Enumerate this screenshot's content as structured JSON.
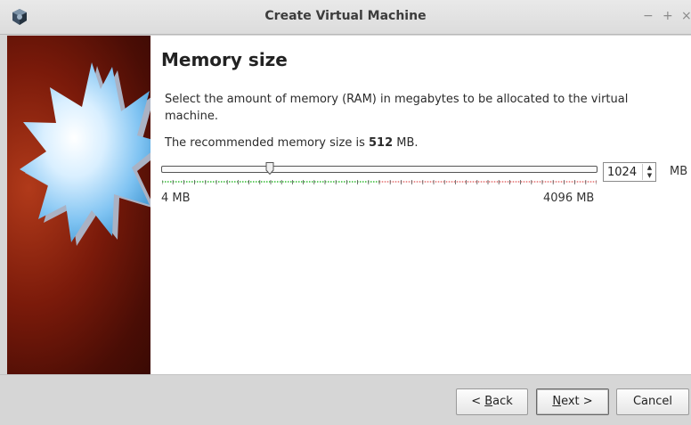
{
  "window": {
    "title": "Create Virtual Machine",
    "controls": {
      "minimize": "−",
      "maximize": "+",
      "close": "×"
    }
  },
  "page": {
    "title": "Memory size",
    "description": "Select the amount of memory (RAM) in megabytes to be allocated to the virtual machine.",
    "recommend_prefix": "The recommended memory size is ",
    "recommend_value": "512",
    "recommend_suffix": " MB."
  },
  "memory": {
    "slider_min_label": "4 MB",
    "slider_max_label": "4096 MB",
    "min_mb": 4,
    "max_mb": 4096,
    "value_mb": 1024,
    "spinbox_value": "1024",
    "unit": "MB",
    "safe_zone_color": "#33bb33",
    "warning_zone_color": "#e46b6b"
  },
  "buttons": {
    "back_prefix": "< ",
    "back_mnemonic": "B",
    "back_rest": "ack",
    "next_mnemonic": "N",
    "next_rest": "ext >",
    "cancel": "Cancel"
  },
  "icons": {
    "app": "virtualbox-cube-icon",
    "spin_up": "spin-up-arrow-icon",
    "spin_down": "spin-down-arrow-icon"
  }
}
